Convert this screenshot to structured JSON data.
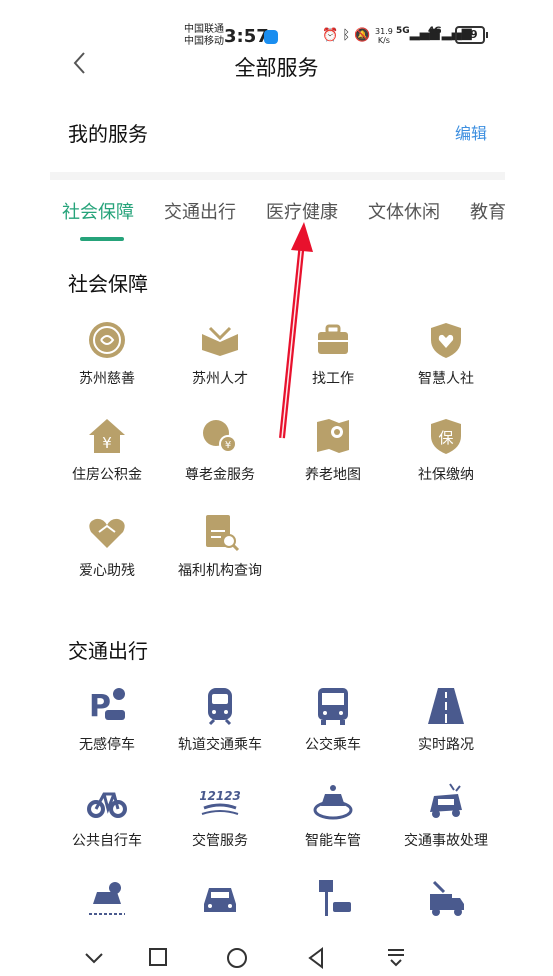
{
  "status": {
    "carrier1": "中国联通",
    "carrier2": "中国移动",
    "time": "3:57",
    "speed_value": "31.9",
    "speed_unit": "K/s",
    "net1": "5G",
    "net2": "4G",
    "battery": "49"
  },
  "header": {
    "title": "全部服务"
  },
  "my_services": {
    "title": "我的服务",
    "edit": "编辑"
  },
  "tabs": [
    "社会保障",
    "交通出行",
    "医疗健康",
    "文体休闲",
    "教育"
  ],
  "active_tab": 0,
  "sections": [
    {
      "title": "社会保障",
      "items": [
        {
          "label": "苏州慈善",
          "icon": "charity-seal-icon"
        },
        {
          "label": "苏州人才",
          "icon": "open-book-icon"
        },
        {
          "label": "找工作",
          "icon": "briefcase-icon"
        },
        {
          "label": "智慧人社",
          "icon": "shield-heart-icon"
        },
        {
          "label": "住房公积金",
          "icon": "house-yuan-icon"
        },
        {
          "label": "尊老金服务",
          "icon": "elder-yuan-icon"
        },
        {
          "label": "养老地图",
          "icon": "map-pin-icon"
        },
        {
          "label": "社保缴纳",
          "icon": "shield-bao-icon"
        },
        {
          "label": "爱心助残",
          "icon": "heart-hands-icon"
        },
        {
          "label": "福利机构查询",
          "icon": "document-search-icon"
        }
      ]
    },
    {
      "title": "交通出行",
      "items": [
        {
          "label": "无感停车",
          "icon": "parking-car-icon"
        },
        {
          "label": "轨道交通乘车",
          "icon": "metro-icon"
        },
        {
          "label": "公交乘车",
          "icon": "bus-icon"
        },
        {
          "label": "实时路况",
          "icon": "road-icon"
        },
        {
          "label": "公共自行车",
          "icon": "bicycle-icon"
        },
        {
          "label": "交管服务",
          "icon": "traffic-12123-icon"
        },
        {
          "label": "智能车管",
          "icon": "smart-car-icon"
        },
        {
          "label": "交通事故处理",
          "icon": "car-accident-icon"
        }
      ]
    }
  ],
  "traffic_badge": "12123",
  "colors": {
    "accent": "#26a37a",
    "gold": "#b8a06a",
    "navy": "#4a5a8e",
    "arrow": "#e8112d",
    "link": "#3d8fe0"
  }
}
